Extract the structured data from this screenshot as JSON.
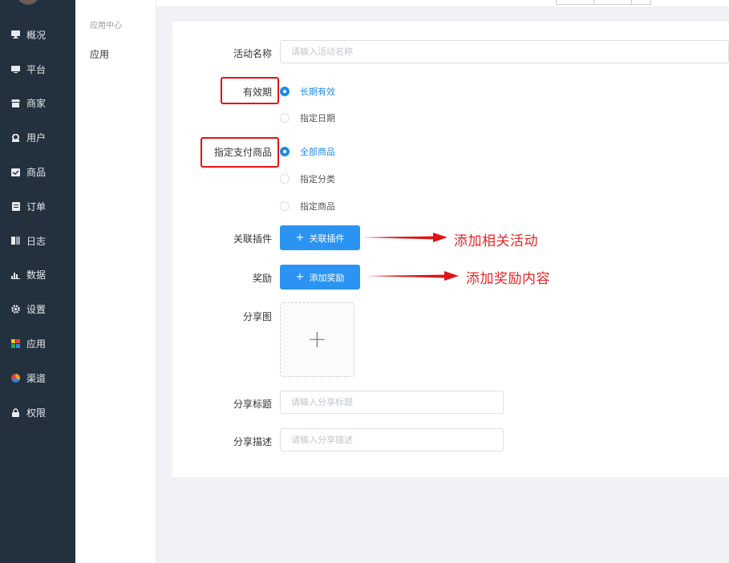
{
  "sidebar": {
    "items": [
      {
        "label": "概况",
        "icon": "monitor-icon"
      },
      {
        "label": "平台",
        "icon": "screen-icon"
      },
      {
        "label": "商家",
        "icon": "store-icon"
      },
      {
        "label": "用户",
        "icon": "user-icon"
      },
      {
        "label": "商品",
        "icon": "goods-icon"
      },
      {
        "label": "订单",
        "icon": "order-icon"
      },
      {
        "label": "日志",
        "icon": "log-icon"
      },
      {
        "label": "数据",
        "icon": "chart-icon"
      },
      {
        "label": "设置",
        "icon": "gear-icon"
      },
      {
        "label": "应用",
        "icon": "apps-icon"
      },
      {
        "label": "渠道",
        "icon": "channel-icon"
      },
      {
        "label": "权限",
        "icon": "lock-icon"
      }
    ]
  },
  "subnav": {
    "title": "应用中心",
    "item": "应用"
  },
  "form": {
    "name_label": "活动名称",
    "name_placeholder": "请输入活动名称",
    "validity_label": "有效期",
    "validity_options": [
      "长期有效",
      "指定日期"
    ],
    "goods_label": "指定支付商品",
    "goods_options": [
      "全部商品",
      "指定分类",
      "指定商品"
    ],
    "plugin_label": "关联插件",
    "plugin_button": "关联插件",
    "reward_label": "奖励",
    "reward_button": "添加奖励",
    "share_image_label": "分享图",
    "share_title_label": "分享标题",
    "share_title_placeholder": "请输入分享标题",
    "share_desc_label": "分享描述",
    "share_desc_placeholder": "请输入分享描述"
  },
  "annotations": {
    "note_plugin": "添加相关活动",
    "note_reward": "添加奖励内容"
  },
  "colors": {
    "sidebar_bg": "#23313e",
    "accent": "#2b93f1",
    "annotation_red": "#e01414"
  }
}
